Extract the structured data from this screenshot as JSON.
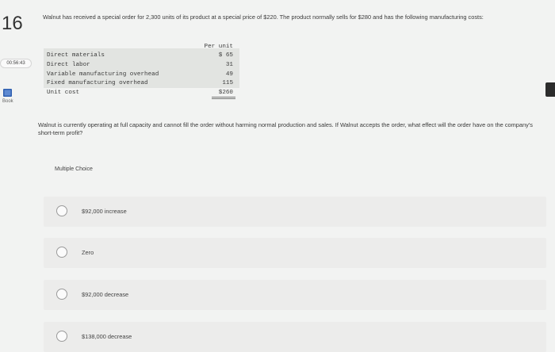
{
  "sidebar": {
    "question_number": "16",
    "timer": "00:56:43",
    "book_label": "Book"
  },
  "question": {
    "text": "Walnut has received a special order for 2,300 units of its product at a special price of $220. The product normally sells for $280 and has the following manufacturing costs:",
    "prompt": "Walnut is currently operating at full capacity and cannot fill the order without harming normal production and sales. If Walnut accepts the order, what effect will the order have on the company's short-term profit?"
  },
  "cost_table": {
    "header": "Per unit",
    "rows": [
      {
        "label": "Direct materials",
        "value": "$ 65"
      },
      {
        "label": "Direct labor",
        "value": "31"
      },
      {
        "label": "Variable manufacturing overhead",
        "value": "49"
      },
      {
        "label": "Fixed manufacturing overhead",
        "value": "115"
      },
      {
        "label": "Unit cost",
        "value": "$260"
      }
    ]
  },
  "multiple_choice": {
    "label": "Multiple Choice",
    "options": [
      {
        "text": "$92,000 increase"
      },
      {
        "text": "Zero"
      },
      {
        "text": "$92,000 decrease"
      },
      {
        "text": "$138,000 decrease"
      }
    ]
  }
}
